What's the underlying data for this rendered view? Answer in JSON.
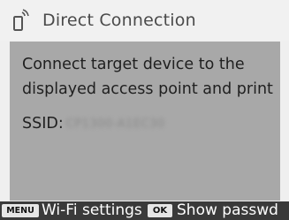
{
  "header": {
    "title": "Direct Connection",
    "icon": "phone-wireless-icon"
  },
  "content": {
    "message_line1": "Connect target device to the",
    "message_line2": "displayed access point and print",
    "ssid_label": "SSID:",
    "ssid_value": "CP1300-A1EC30"
  },
  "footer": {
    "menu_badge": "MENU",
    "menu_action": "Wi-Fi settings",
    "ok_badge": "OK",
    "ok_action": "Show passwd"
  },
  "colors": {
    "header_bg": "#f1f1f1",
    "content_bg": "#a8a8a8",
    "footer_bg": "#3a3a3a",
    "badge_bg": "#e6e6e6"
  }
}
